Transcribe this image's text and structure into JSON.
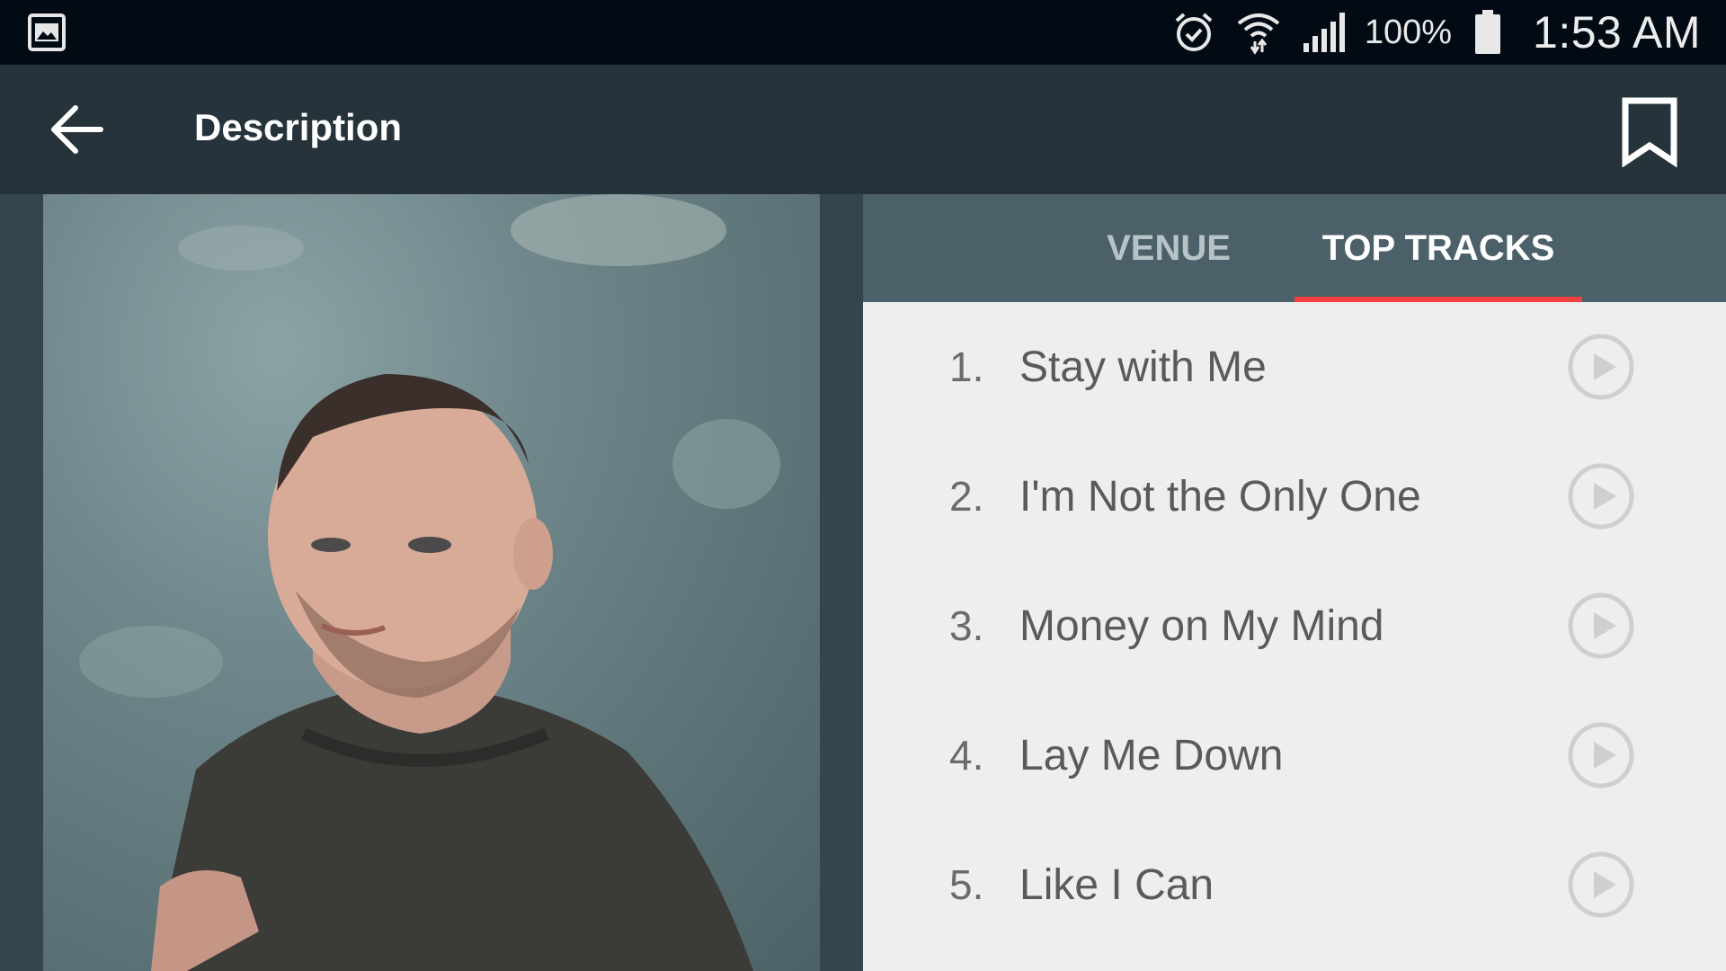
{
  "status_bar": {
    "battery_percent": "100%",
    "time": "1:53 AM",
    "icons": [
      "gallery-icon",
      "alarm-icon",
      "wifi-icon",
      "signal-icon",
      "battery-icon"
    ]
  },
  "app_bar": {
    "title": "Description",
    "icons": [
      "back-arrow-icon",
      "bookmark-icon"
    ]
  },
  "tabs": [
    {
      "label": "VENUE",
      "selected": false
    },
    {
      "label": "TOP TRACKS",
      "selected": true
    }
  ],
  "tracks": [
    {
      "number": "1.",
      "title": "Stay with Me"
    },
    {
      "number": "2.",
      "title": "I'm Not the Only One"
    },
    {
      "number": "3.",
      "title": "Money on My Mind"
    },
    {
      "number": "4.",
      "title": "Lay Me Down"
    },
    {
      "number": "5.",
      "title": "Like I Can"
    }
  ],
  "colors": {
    "status_bar_bg": "#020b14",
    "app_bar_bg": "#26333b",
    "tab_bar_bg": "#4b6069",
    "tab_indicator": "#f13e3e",
    "list_bg": "#eeeeee"
  }
}
